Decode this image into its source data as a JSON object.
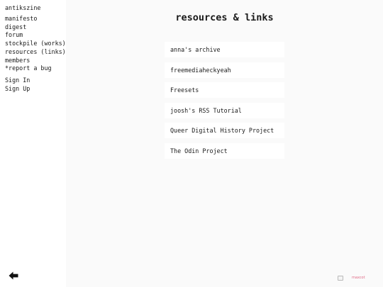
{
  "sidebar": {
    "brand": "antikszine",
    "nav": [
      "manifesto",
      "digest",
      "forum",
      "stockpile (works)",
      "resources (links)",
      "members",
      "*report a bug"
    ],
    "auth": [
      "Sign In",
      "Sign Up"
    ],
    "back_icon": "arrow-left-icon"
  },
  "main": {
    "title": "resources & links",
    "links": [
      "anna's archive",
      "freemediaheckyeah",
      "Freesets",
      "joosh's RSS Tutorial",
      "Queer Digital History Project",
      "The Odin Project"
    ]
  },
  "footer": {
    "badge_text": "maxcot",
    "badge_icon": "broken-image-icon",
    "badge_color": "#e06a86"
  }
}
